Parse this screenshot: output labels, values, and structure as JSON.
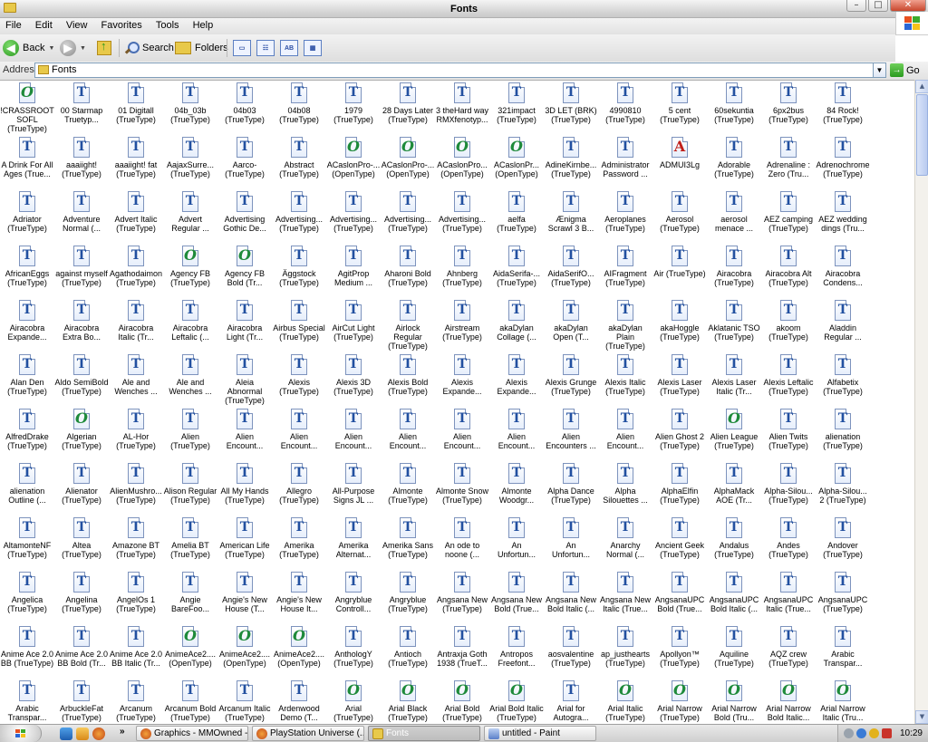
{
  "window": {
    "title": "Fonts",
    "buttons": {
      "minimize": "–",
      "maximize": "□",
      "close": "✕"
    }
  },
  "menu": [
    "File",
    "Edit",
    "View",
    "Favorites",
    "Tools",
    "Help"
  ],
  "toolbar": {
    "back_label": "Back",
    "search_label": "Search",
    "folders_label": "Folders",
    "view_icons": [
      "▭",
      "☷",
      "AB",
      "▦"
    ]
  },
  "address": {
    "label": "Address",
    "value": "Fonts",
    "go_label": "Go"
  },
  "fonts": [
    {
      "n": "!CRASSROOT\nSOFL\n(TrueType)",
      "t": "ot"
    },
    {
      "n": "00 Starmap\nTruetyp...",
      "t": "tt"
    },
    {
      "n": "01 Digitall\n(TrueType)",
      "t": "tt"
    },
    {
      "n": "04b_03b\n(TrueType)",
      "t": "tt"
    },
    {
      "n": "04b03\n(TrueType)",
      "t": "tt"
    },
    {
      "n": "04b08\n(TrueType)",
      "t": "tt"
    },
    {
      "n": "1979\n(TrueType)",
      "t": "tt"
    },
    {
      "n": "28 Days Later\n(TrueType)",
      "t": "tt"
    },
    {
      "n": "3 theHard way\nRMXfenotyp...",
      "t": "tt"
    },
    {
      "n": "321impact\n(TrueType)",
      "t": "tt"
    },
    {
      "n": "3D LET (BRK)\n(TrueType)",
      "t": "tt"
    },
    {
      "n": "4990810\n(TrueType)",
      "t": "tt"
    },
    {
      "n": "5 cent\n(TrueType)",
      "t": "tt"
    },
    {
      "n": "60sekuntia\n(TrueType)",
      "t": "tt"
    },
    {
      "n": "6px2bus\n(TrueType)",
      "t": "tt"
    },
    {
      "n": "84 Rock!\n(TrueType)",
      "t": "tt"
    },
    {
      "n": "A Drink For All\nAges (True...",
      "t": "tt"
    },
    {
      "n": "aaaiight!\n(TrueType)",
      "t": "tt"
    },
    {
      "n": "aaaiight! fat\n(TrueType)",
      "t": "tt"
    },
    {
      "n": "AajaxSurre...\n(TrueType)",
      "t": "tt"
    },
    {
      "n": "Aarco-\n(TrueType)",
      "t": "tt"
    },
    {
      "n": "Abstract\n(TrueType)",
      "t": "tt"
    },
    {
      "n": "ACaslonPro-...\n(OpenType)",
      "t": "ot"
    },
    {
      "n": "ACaslonPro-...\n(OpenType)",
      "t": "ot"
    },
    {
      "n": "ACaslonPro...\n(OpenType)",
      "t": "ot"
    },
    {
      "n": "ACaslonPr...\n(OpenType)",
      "t": "ot"
    },
    {
      "n": "AdineKirnbe...\n(TrueType)",
      "t": "tt"
    },
    {
      "n": "Administrator\nPassword ...",
      "t": "tt"
    },
    {
      "n": "ADMUI3Lg",
      "t": "a"
    },
    {
      "n": "Adorable\n(TrueType)",
      "t": "tt"
    },
    {
      "n": "Adrenaline :\nZero (Tru...",
      "t": "tt"
    },
    {
      "n": "Adrenochrome\n(TrueType)",
      "t": "tt"
    },
    {
      "n": "Adriator\n(TrueType)",
      "t": "tt"
    },
    {
      "n": "Adventure\nNormal (...",
      "t": "tt"
    },
    {
      "n": "Advert Italic\n(TrueType)",
      "t": "tt"
    },
    {
      "n": "Advert\nRegular ...",
      "t": "tt"
    },
    {
      "n": "Advertising\nGothic De...",
      "t": "tt"
    },
    {
      "n": "Advertising...\n(TrueType)",
      "t": "tt"
    },
    {
      "n": "Advertising...\n(TrueType)",
      "t": "tt"
    },
    {
      "n": "Advertising...\n(TrueType)",
      "t": "tt"
    },
    {
      "n": "Advertising...\n(TrueType)",
      "t": "tt"
    },
    {
      "n": "aelfa\n(TrueType)",
      "t": "tt"
    },
    {
      "n": "Ænigma\nScrawl 3 B...",
      "t": "tt"
    },
    {
      "n": "Aeroplanes\n(TrueType)",
      "t": "tt"
    },
    {
      "n": "Aerosol\n(TrueType)",
      "t": "tt"
    },
    {
      "n": "aerosol\nmenace ...",
      "t": "tt"
    },
    {
      "n": "AEZ camping\n(TrueType)",
      "t": "tt"
    },
    {
      "n": "AEZ wedding\ndings (Tru...",
      "t": "tt"
    },
    {
      "n": "AfricanEggs\n(TrueType)",
      "t": "tt"
    },
    {
      "n": "against myself\n(TrueType)",
      "t": "tt"
    },
    {
      "n": "Agathodaimon\n(TrueType)",
      "t": "tt"
    },
    {
      "n": "Agency FB\n(TrueType)",
      "t": "ot"
    },
    {
      "n": "Agency FB\nBold (Tr...",
      "t": "ot"
    },
    {
      "n": "Äggstock\n(TrueType)",
      "t": "tt"
    },
    {
      "n": "AgitProp\nMedium ...",
      "t": "tt"
    },
    {
      "n": "Aharoni Bold\n(TrueType)",
      "t": "tt"
    },
    {
      "n": "Ahnberg\n(TrueType)",
      "t": "tt"
    },
    {
      "n": "AidaSerifa-...\n(TrueType)",
      "t": "tt"
    },
    {
      "n": "AidaSerifO...\n(TrueType)",
      "t": "tt"
    },
    {
      "n": "AIFragment\n(TrueType)",
      "t": "tt"
    },
    {
      "n": "Air (TrueType)",
      "t": "tt"
    },
    {
      "n": "Airacobra\n(TrueType)",
      "t": "tt"
    },
    {
      "n": "Airacobra Alt\n(TrueType)",
      "t": "tt"
    },
    {
      "n": "Airacobra\nCondens...",
      "t": "tt"
    },
    {
      "n": "Airacobra\nExpande...",
      "t": "tt"
    },
    {
      "n": "Airacobra\nExtra Bo...",
      "t": "tt"
    },
    {
      "n": "Airacobra\nItalic (Tr...",
      "t": "tt"
    },
    {
      "n": "Airacobra\nLeftalic (...",
      "t": "tt"
    },
    {
      "n": "Airacobra\nLight (Tr...",
      "t": "tt"
    },
    {
      "n": "Airbus Special\n(TrueType)",
      "t": "tt"
    },
    {
      "n": "AirCut Light\n(TrueType)",
      "t": "tt"
    },
    {
      "n": "Airlock Regular\n(TrueType)",
      "t": "tt"
    },
    {
      "n": "Airstream\n(TrueType)",
      "t": "tt"
    },
    {
      "n": "akaDylan\nCollage (...",
      "t": "tt"
    },
    {
      "n": "akaDylan\nOpen (T...",
      "t": "tt"
    },
    {
      "n": "akaDylan Plain\n(TrueType)",
      "t": "tt"
    },
    {
      "n": "akaHoggle\n(TrueType)",
      "t": "tt"
    },
    {
      "n": "Aklatanic TSO\n(TrueType)",
      "t": "tt"
    },
    {
      "n": "akoom\n(TrueType)",
      "t": "tt"
    },
    {
      "n": "Aladdin\nRegular ...",
      "t": "tt"
    },
    {
      "n": "Alan Den\n(TrueType)",
      "t": "tt"
    },
    {
      "n": "Aldo SemiBold\n(TrueType)",
      "t": "tt"
    },
    {
      "n": "Ale and\nWenches ...",
      "t": "tt"
    },
    {
      "n": "Ale and\nWenches ...",
      "t": "tt"
    },
    {
      "n": "Aleia Abnormal\n(TrueType)",
      "t": "tt"
    },
    {
      "n": "Alexis\n(TrueType)",
      "t": "tt"
    },
    {
      "n": "Alexis 3D\n(TrueType)",
      "t": "tt"
    },
    {
      "n": "Alexis Bold\n(TrueType)",
      "t": "tt"
    },
    {
      "n": "Alexis\nExpande...",
      "t": "tt"
    },
    {
      "n": "Alexis\nExpande...",
      "t": "tt"
    },
    {
      "n": "Alexis Grunge\n(TrueType)",
      "t": "tt"
    },
    {
      "n": "Alexis Italic\n(TrueType)",
      "t": "tt"
    },
    {
      "n": "Alexis Laser\n(TrueType)",
      "t": "tt"
    },
    {
      "n": "Alexis Laser\nItalic (Tr...",
      "t": "tt"
    },
    {
      "n": "Alexis Leftalic\n(TrueType)",
      "t": "tt"
    },
    {
      "n": "Alfabetix\n(TrueType)",
      "t": "tt"
    },
    {
      "n": "AlfredDrake\n(TrueType)",
      "t": "tt"
    },
    {
      "n": "Algerian\n(TrueType)",
      "t": "ot"
    },
    {
      "n": "AL-Hor\n(TrueType)",
      "t": "tt"
    },
    {
      "n": "Alien\n(TrueType)",
      "t": "tt"
    },
    {
      "n": "Alien\nEncount...",
      "t": "tt"
    },
    {
      "n": "Alien\nEncount...",
      "t": "tt"
    },
    {
      "n": "Alien\nEncount...",
      "t": "tt"
    },
    {
      "n": "Alien\nEncount...",
      "t": "tt"
    },
    {
      "n": "Alien\nEncount...",
      "t": "tt"
    },
    {
      "n": "Alien\nEncount...",
      "t": "tt"
    },
    {
      "n": "Alien\nEncounters ...",
      "t": "tt"
    },
    {
      "n": "Alien\nEncount...",
      "t": "tt"
    },
    {
      "n": "Alien Ghost 2\n(TrueType)",
      "t": "tt"
    },
    {
      "n": "Alien League\n(TrueType)",
      "t": "ot"
    },
    {
      "n": "Alien Twits\n(TrueType)",
      "t": "tt"
    },
    {
      "n": "alienation\n(TrueType)",
      "t": "tt"
    },
    {
      "n": "alienation\nOutline (...",
      "t": "tt"
    },
    {
      "n": "Alienator\n(TrueType)",
      "t": "tt"
    },
    {
      "n": "AlienMushro...\n(TrueType)",
      "t": "tt"
    },
    {
      "n": "Alison Regular\n(TrueType)",
      "t": "tt"
    },
    {
      "n": "All My Hands\n(TrueType)",
      "t": "tt"
    },
    {
      "n": "Allegro\n(TrueType)",
      "t": "tt"
    },
    {
      "n": "All-Purpose\nSigns JL ...",
      "t": "tt"
    },
    {
      "n": "Almonte\n(TrueType)",
      "t": "tt"
    },
    {
      "n": "Almonte Snow\n(TrueType)",
      "t": "tt"
    },
    {
      "n": "Almonte\nWoodgr...",
      "t": "tt"
    },
    {
      "n": "Alpha Dance\n(TrueType)",
      "t": "tt"
    },
    {
      "n": "Alpha\nSilouettes ...",
      "t": "tt"
    },
    {
      "n": "AlphaElfin\n(TrueType)",
      "t": "tt"
    },
    {
      "n": "AlphaMack\nAOE (Tr...",
      "t": "tt"
    },
    {
      "n": "Alpha-Silou...\n(TrueType)",
      "t": "tt"
    },
    {
      "n": "Alpha-Silou...\n2 (TrueType)",
      "t": "tt"
    },
    {
      "n": "AltamonteNF\n(TrueType)",
      "t": "tt"
    },
    {
      "n": "Altea\n(TrueType)",
      "t": "tt"
    },
    {
      "n": "Amazone BT\n(TrueType)",
      "t": "tt"
    },
    {
      "n": "Amelia BT\n(TrueType)",
      "t": "tt"
    },
    {
      "n": "American Life\n(TrueType)",
      "t": "tt"
    },
    {
      "n": "Amerika\n(TrueType)",
      "t": "tt"
    },
    {
      "n": "Amerika\nAlternat...",
      "t": "tt"
    },
    {
      "n": "Amerika Sans\n(TrueType)",
      "t": "tt"
    },
    {
      "n": "An ode to\nnoone (...",
      "t": "tt"
    },
    {
      "n": "An\nUnfortun...",
      "t": "tt"
    },
    {
      "n": "An\nUnfortun...",
      "t": "tt"
    },
    {
      "n": "Anarchy\nNormal (...",
      "t": "tt"
    },
    {
      "n": "Ancient Geek\n(TrueType)",
      "t": "tt"
    },
    {
      "n": "Andalus\n(TrueType)",
      "t": "tt"
    },
    {
      "n": "Andes\n(TrueType)",
      "t": "tt"
    },
    {
      "n": "Andover\n(TrueType)",
      "t": "tt"
    },
    {
      "n": "Angelica\n(TrueType)",
      "t": "tt"
    },
    {
      "n": "Angelina\n(TrueType)",
      "t": "tt"
    },
    {
      "n": "AngelOs 1\n(TrueType)",
      "t": "tt"
    },
    {
      "n": "Angie\nBareFoo...",
      "t": "tt"
    },
    {
      "n": "Angie's New\nHouse (T...",
      "t": "tt"
    },
    {
      "n": "Angie's New\nHouse It...",
      "t": "tt"
    },
    {
      "n": "Angryblue\nControll...",
      "t": "tt"
    },
    {
      "n": "Angryblue\n(TrueType)",
      "t": "tt"
    },
    {
      "n": "Angsana New\n(TrueType)",
      "t": "tt"
    },
    {
      "n": "Angsana New\nBold (True...",
      "t": "tt"
    },
    {
      "n": "Angsana New\nBold Italic (...",
      "t": "tt"
    },
    {
      "n": "Angsana New\nItalic (True...",
      "t": "tt"
    },
    {
      "n": "AngsanaUPC\nBold (True...",
      "t": "tt"
    },
    {
      "n": "AngsanaUPC\nBold Italic (...",
      "t": "tt"
    },
    {
      "n": "AngsanaUPC\nItalic (True...",
      "t": "tt"
    },
    {
      "n": "AngsanaUPC\n(TrueType)",
      "t": "tt"
    },
    {
      "n": "Anime Ace 2.0\nBB (TrueType)",
      "t": "tt"
    },
    {
      "n": "Anime Ace 2.0\nBB Bold (Tr...",
      "t": "tt"
    },
    {
      "n": "Anime Ace 2.0\nBB Italic (Tr...",
      "t": "tt"
    },
    {
      "n": "AnimeAce2....\n(OpenType)",
      "t": "ot"
    },
    {
      "n": "AnimeAce2....\n(OpenType)",
      "t": "ot"
    },
    {
      "n": "AnimeAce2....\n(OpenType)",
      "t": "ot"
    },
    {
      "n": "AnthologY\n(TrueType)",
      "t": "tt"
    },
    {
      "n": "Antioch\n(TrueType)",
      "t": "tt"
    },
    {
      "n": "Antraxja Goth\n1938 (TrueT...",
      "t": "tt"
    },
    {
      "n": "Antropos\nFreefont...",
      "t": "tt"
    },
    {
      "n": "aosvalentine\n(TrueType)",
      "t": "tt"
    },
    {
      "n": "ap_justhearts\n(TrueType)",
      "t": "tt"
    },
    {
      "n": "Apollyon™\n(TrueType)",
      "t": "tt"
    },
    {
      "n": "Aquiline\n(TrueType)",
      "t": "tt"
    },
    {
      "n": "AQZ crew\n(TrueType)",
      "t": "tt"
    },
    {
      "n": "Arabic\nTranspar...",
      "t": "tt"
    },
    {
      "n": "Arabic\nTranspar...",
      "t": "tt"
    },
    {
      "n": "ArbuckleFat\n(TrueType)",
      "t": "tt"
    },
    {
      "n": "Arcanum\n(TrueType)",
      "t": "tt"
    },
    {
      "n": "Arcanum Bold\n(TrueType)",
      "t": "tt"
    },
    {
      "n": "Arcanum Italic\n(TrueType)",
      "t": "tt"
    },
    {
      "n": "Ardenwood\nDemo (T...",
      "t": "tt"
    },
    {
      "n": "Arial\n(TrueType)",
      "t": "ot"
    },
    {
      "n": "Arial Black\n(TrueType)",
      "t": "ot"
    },
    {
      "n": "Arial Bold\n(TrueType)",
      "t": "ot"
    },
    {
      "n": "Arial Bold Italic\n(TrueType)",
      "t": "ot"
    },
    {
      "n": "Arial for\nAutogra...",
      "t": "tt"
    },
    {
      "n": "Arial Italic\n(TrueType)",
      "t": "ot"
    },
    {
      "n": "Arial Narrow\n(TrueType)",
      "t": "ot"
    },
    {
      "n": "Arial Narrow\nBold (Tru...",
      "t": "ot"
    },
    {
      "n": "Arial Narrow\nBold Italic...",
      "t": "ot"
    },
    {
      "n": "Arial Narrow\nItalic (Tru...",
      "t": "ot"
    }
  ],
  "taskbar": {
    "tasks": [
      {
        "label": "Graphics - MMOwned - ...",
        "icon_color": "#d0581a"
      },
      {
        "label": "PlayStation Universe (...",
        "icon_color": "#d0581a"
      },
      {
        "label": "Fonts",
        "icon_color": "#e8c94a"
      },
      {
        "label": "untitled - Paint",
        "icon_color": "#5a7fc9"
      }
    ],
    "quicklaunch_more": "»",
    "clock": "10:29"
  },
  "colors": {
    "truetype_glyph": "#2250a0",
    "opentype_glyph": "#1e8a3a",
    "raster_glyph": "#c0201a"
  }
}
